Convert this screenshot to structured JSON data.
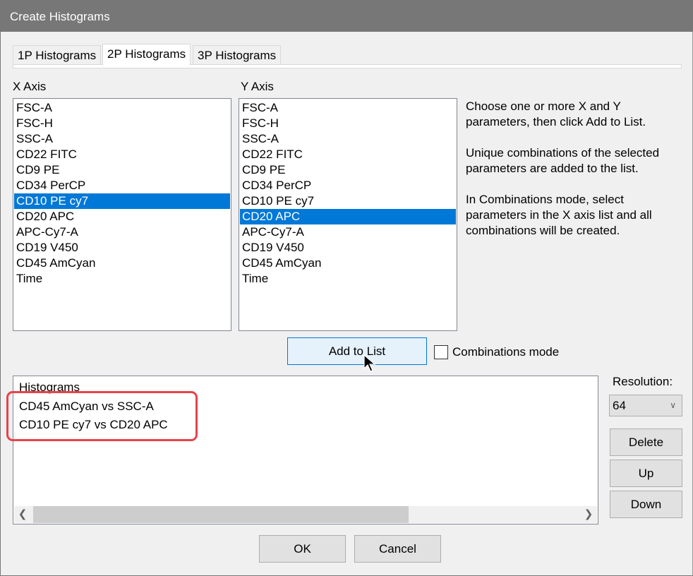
{
  "window": {
    "title": "Create Histograms"
  },
  "tabs": [
    {
      "label": "1P Histograms",
      "active": false
    },
    {
      "label": "2P Histograms",
      "active": true
    },
    {
      "label": "3P Histograms",
      "active": false
    }
  ],
  "x_axis": {
    "label": "X Axis",
    "items": [
      "FSC-A",
      "FSC-H",
      "SSC-A",
      "CD22 FITC",
      "CD9 PE",
      "CD34 PerCP",
      "CD10 PE cy7",
      "CD20 APC",
      "APC-Cy7-A",
      "CD19 V450",
      "CD45 AmCyan",
      "Time"
    ],
    "selected": "CD10 PE cy7"
  },
  "y_axis": {
    "label": "Y Axis",
    "items": [
      "FSC-A",
      "FSC-H",
      "SSC-A",
      "CD22 FITC",
      "CD9 PE",
      "CD34 PerCP",
      "CD10 PE cy7",
      "CD20 APC",
      "APC-Cy7-A",
      "CD19 V450",
      "CD45 AmCyan",
      "Time"
    ],
    "selected": "CD20 APC"
  },
  "help_text": [
    "Choose one or more X and Y parameters, then click Add to List.",
    "Unique combinations of the selected parameters are added to the list.",
    "In Combinations mode, select parameters in the X axis list and all combinations will be created."
  ],
  "add_to_list_label": "Add to List",
  "combinations_mode": {
    "label": "Combinations mode",
    "checked": false
  },
  "histograms": {
    "header": "Histograms",
    "items": [
      "CD45 AmCyan vs SSC-A",
      "CD10 PE cy7 vs CD20 APC"
    ]
  },
  "resolution": {
    "label": "Resolution:",
    "value": "64"
  },
  "buttons": {
    "delete": "Delete",
    "up": "Up",
    "down": "Down",
    "ok": "OK",
    "cancel": "Cancel"
  },
  "colors": {
    "selection": "#0078d7",
    "highlight_annotation": "#e8434b",
    "titlebar": "#777777"
  }
}
